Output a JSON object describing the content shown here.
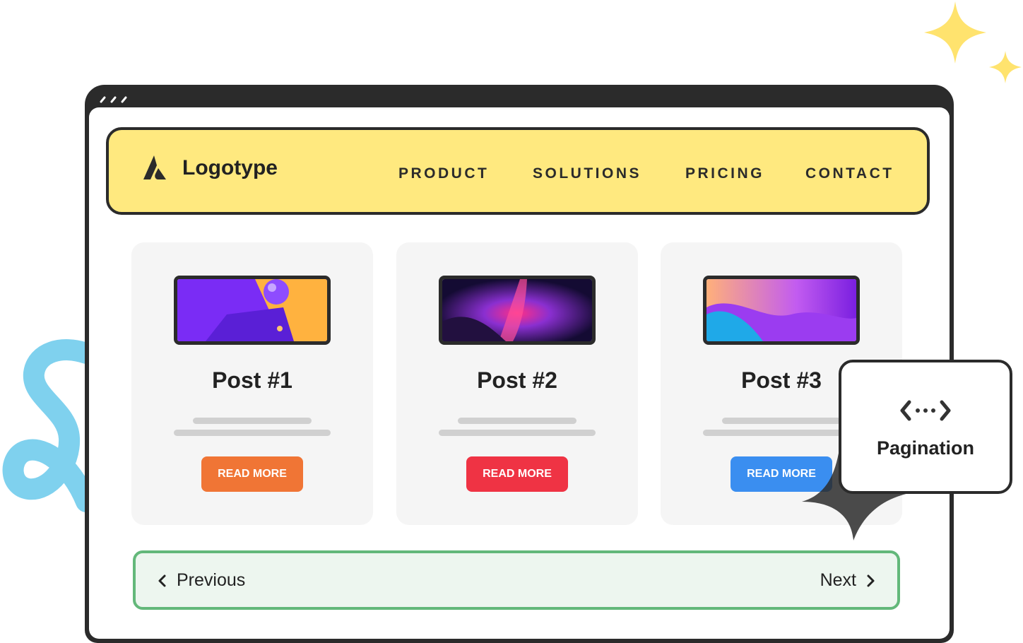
{
  "brand": {
    "name": "Logotype"
  },
  "nav": {
    "items": [
      {
        "label": "PRODUCT"
      },
      {
        "label": "SOLUTIONS"
      },
      {
        "label": "PRICING"
      },
      {
        "label": "CONTACT"
      }
    ]
  },
  "posts": [
    {
      "title": "Post #1",
      "button_label": "READ MORE",
      "button_color": "#f07535"
    },
    {
      "title": "Post #2",
      "button_label": "READ MORE",
      "button_color": "#ef3344"
    },
    {
      "title": "Post #3",
      "button_label": "READ MORE",
      "button_color": "#3a8ef0"
    }
  ],
  "pagination": {
    "previous_label": "Previous",
    "next_label": "Next"
  },
  "tooltip": {
    "label": "Pagination",
    "icon": "pagination-icon"
  },
  "colors": {
    "navbar_bg": "#ffe97f",
    "pagination_bg": "#edf6ef",
    "pagination_border": "#63b87a",
    "frame": "#2b2b2b"
  }
}
